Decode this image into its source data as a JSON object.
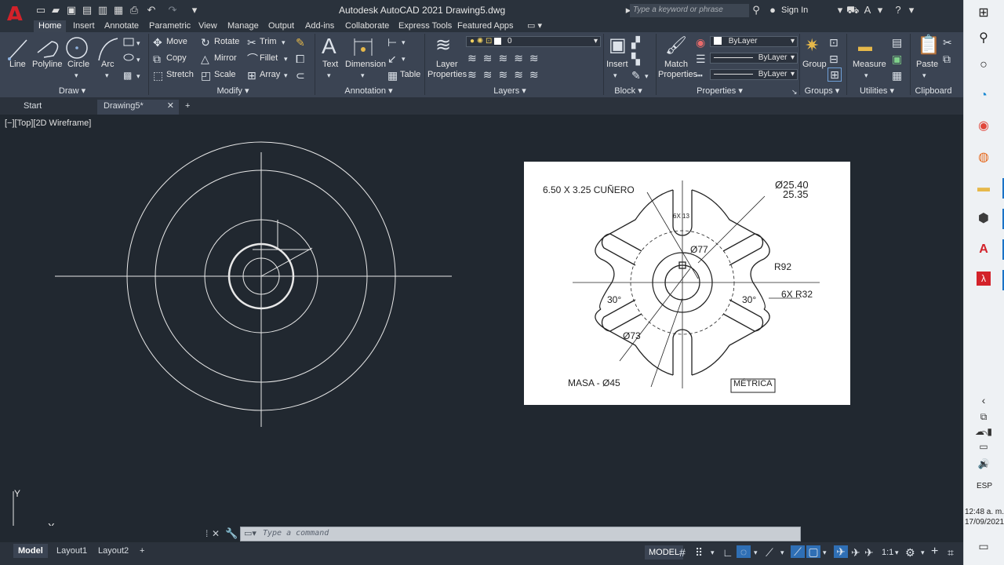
{
  "titlebar": {
    "title": "Autodesk AutoCAD 2021    Drawing5.dwg",
    "search_placeholder": "Type a keyword or phrase",
    "sign_in": "Sign In"
  },
  "ribbon_tabs": [
    "Home",
    "Insert",
    "Annotate",
    "Parametric",
    "View",
    "Manage",
    "Output",
    "Add-ins",
    "Collaborate",
    "Express Tools",
    "Featured Apps"
  ],
  "ribbon": {
    "draw": {
      "title": "Draw",
      "line": "Line",
      "polyline": "Polyline",
      "circle": "Circle",
      "arc": "Arc"
    },
    "modify": {
      "title": "Modify",
      "move": "Move",
      "rotate": "Rotate",
      "trim": "Trim",
      "copy": "Copy",
      "mirror": "Mirror",
      "fillet": "Fillet",
      "stretch": "Stretch",
      "scale": "Scale",
      "array": "Array"
    },
    "annotation": {
      "title": "Annotation",
      "text": "Text",
      "dimension": "Dimension",
      "table": "Table"
    },
    "layers": {
      "title": "Layers",
      "layer_properties_1": "Layer",
      "layer_properties_2": "Properties",
      "current_layer": "0"
    },
    "block": {
      "title": "Block",
      "insert": "Insert"
    },
    "properties": {
      "title": "Properties",
      "match_1": "Match",
      "match_2": "Properties",
      "color": "ByLayer",
      "linetype": "ByLayer",
      "lineweight": "ByLayer"
    },
    "groups": {
      "title": "Groups",
      "group": "Group"
    },
    "utilities": {
      "title": "Utilities",
      "measure": "Measure"
    },
    "clipboard": {
      "title": "Clipboard",
      "paste": "Paste"
    }
  },
  "file_tabs": {
    "start": "Start",
    "drawing": "Drawing5*",
    "add": "+"
  },
  "viewport": {
    "label": "[−][Top][2D Wireframe]"
  },
  "reference_drawing": {
    "keyway": "6.50 X 3.25  CUÑERO",
    "dia_top_1": "Ø25.40",
    "dia_top_2": "25.35",
    "slot": "6X 13",
    "dia77": "Ø77",
    "r92": "R92",
    "angle_left": "30°",
    "angle_right": "30°",
    "r32": "6X R32",
    "dia73": "Ø73",
    "masa": "MASA - Ø45",
    "metrica": "MÉTRICA"
  },
  "ucs": {
    "x": "X",
    "y": "Y"
  },
  "command": {
    "placeholder": "Type  a  command"
  },
  "layout_tabs": [
    "Model",
    "Layout1",
    "Layout2"
  ],
  "status": {
    "model": "MODEL",
    "scale": "1:1"
  },
  "taskbar": {
    "lang": "ESP",
    "time": "12:48 a. m.",
    "date": "17/09/2021"
  },
  "colors": {
    "ribbon_bg": "#3b4453",
    "canvas_bg": "#212830",
    "autocad_red": "#d3222a"
  }
}
